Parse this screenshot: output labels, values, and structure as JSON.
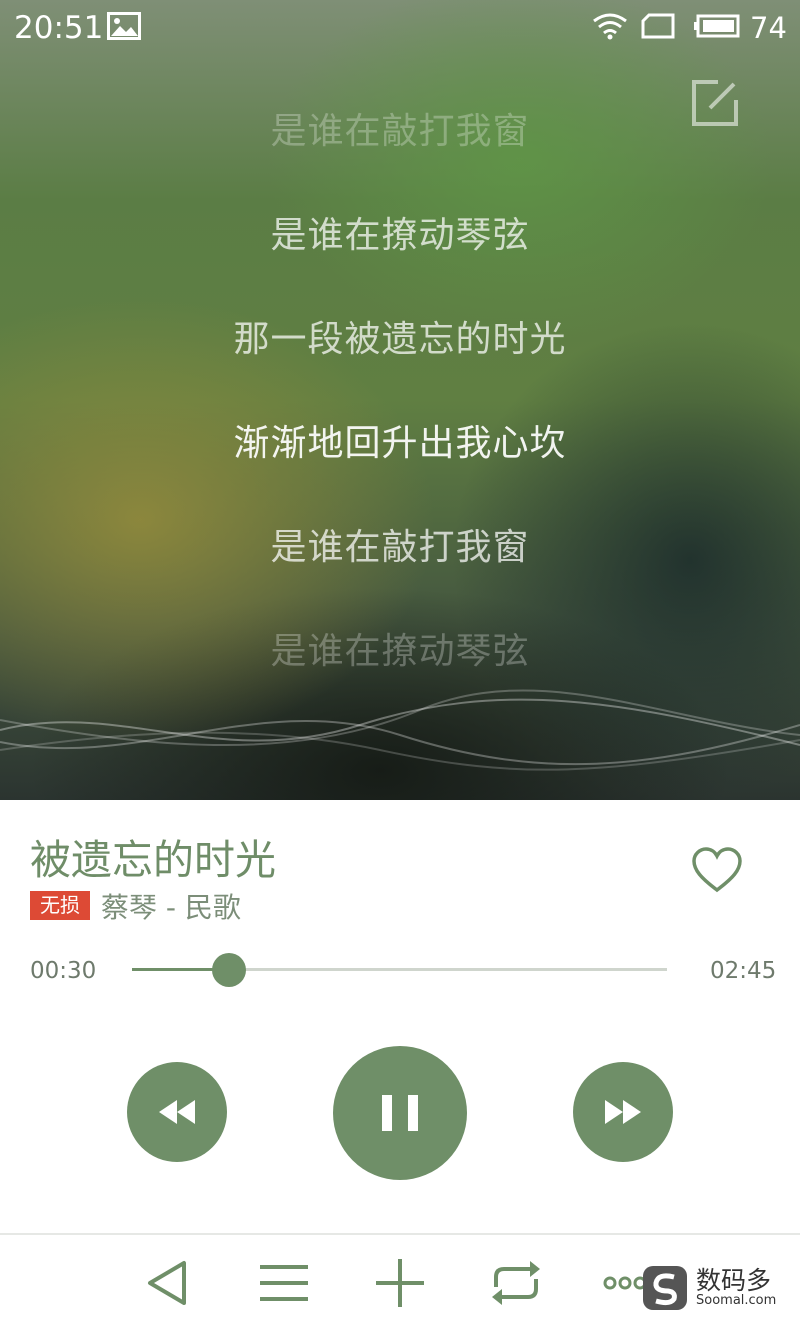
{
  "status_bar": {
    "time": "20:51",
    "battery_percent": "74",
    "icons": [
      "image-icon",
      "wifi-icon",
      "sim-icon",
      "battery-icon"
    ]
  },
  "lyrics": [
    "是谁在敲打我窗",
    "是谁在撩动琴弦",
    "那一段被遗忘的时光",
    "渐渐地回升出我心坎",
    "是谁在敲打我窗",
    "是谁在撩动琴弦"
  ],
  "song": {
    "title": "被遗忘的时光",
    "quality_badge": "无损",
    "artist_album": "蔡琴 - 民歌"
  },
  "progress": {
    "current": "00:30",
    "total": "02:45",
    "fraction": 0.1818
  },
  "colors": {
    "accent": "#6f8f68",
    "badge": "#dd4a35"
  },
  "controls": [
    "rewind-icon",
    "pause-icon",
    "fast-forward-icon"
  ],
  "bottom_nav": [
    "back-icon",
    "playlist-icon",
    "add-icon",
    "repeat-icon",
    "more-icon"
  ],
  "watermark": {
    "cn": "数码多",
    "en": "Soomal.com"
  }
}
